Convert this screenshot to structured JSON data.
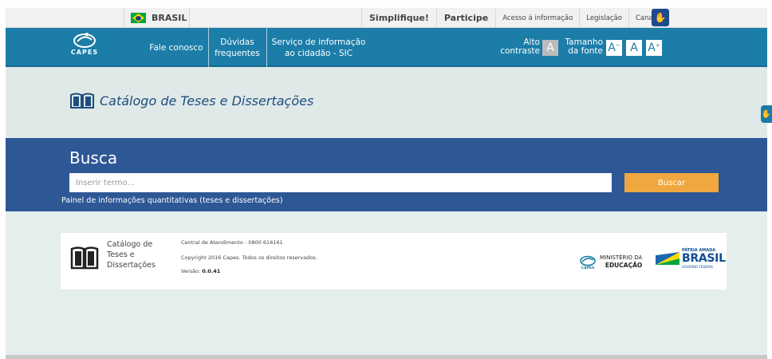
{
  "govbar": {
    "country": "BRASIL",
    "links": [
      "Simplifique!",
      "Participe",
      "Acesso à informação",
      "Legislação",
      "Canais"
    ]
  },
  "header": {
    "logo_text": "CAPES",
    "nav": [
      "Fale conosco",
      "Dúvidas frequentes",
      "Serviço de informação ao cidadão - SIC"
    ],
    "contrast_label": "Alto contraste",
    "contrast_button": "A",
    "font_label": "Tamanho da fonte",
    "font_decrease": "A",
    "font_decrease_mark": "−",
    "font_normal": "A",
    "font_increase": "A",
    "font_increase_mark": "+"
  },
  "title_area": {
    "title": "Catálogo de Teses e Dissertações"
  },
  "search": {
    "heading": "Busca",
    "placeholder": "Inserir termo...",
    "button": "Buscar",
    "panel_link": "Painel de informações quantitativas (teses e dissertações)"
  },
  "footer": {
    "catalog_line1": "Catálogo de",
    "catalog_line2": "Teses e",
    "catalog_line3": "Dissertações",
    "central": "Central de Atendimento - 0800 616161",
    "copyright": "Copyright 2016 Capes. Todos os direitos reservados.",
    "version_label": "Versão:",
    "version": "0.0.41",
    "capes_logo": "CAPES",
    "ministry_line1": "MINISTÉRIO DA",
    "ministry_line2": "EDUCAÇÃO",
    "brasil_small": "PÁTRIA AMADA",
    "brasil_big": "BRASIL",
    "brasil_tiny": "GOVERNO FEDERAL"
  },
  "colors": {
    "header_blue": "#1b7da8",
    "search_blue": "#2e5795",
    "search_button": "#f0a73f",
    "title_blue": "#1e4d7e"
  }
}
